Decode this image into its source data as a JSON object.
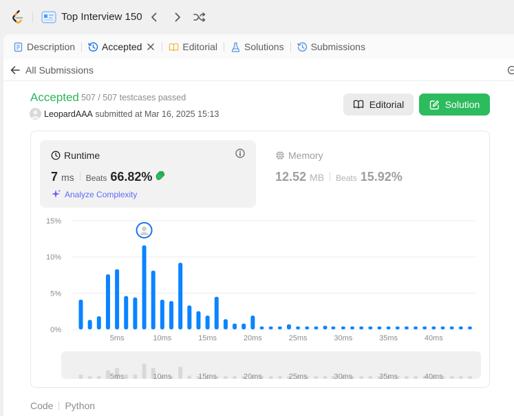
{
  "topbar": {
    "list_title": "Top Interview 150",
    "icons": [
      "leetcode-logo",
      "study-plan-icon",
      "chevron-left-icon",
      "chevron-right-icon",
      "shuffle-icon"
    ]
  },
  "tabs": [
    {
      "label": "Description",
      "icon": "description-icon",
      "active": false
    },
    {
      "label": "Accepted",
      "icon": "history-icon",
      "active": true,
      "closable": true
    },
    {
      "label": "Editorial",
      "icon": "book-icon",
      "active": false
    },
    {
      "label": "Solutions",
      "icon": "flask-icon",
      "active": false
    },
    {
      "label": "Submissions",
      "icon": "history-icon",
      "active": false
    }
  ],
  "crumb": {
    "label": "All Submissions"
  },
  "submission": {
    "status": "Accepted",
    "testcases": "507 / 507 testcases passed",
    "user": "LeopardAAA",
    "submitted_text": "submitted at Mar 16, 2025 15:13"
  },
  "buttons": {
    "editorial": "Editorial",
    "solution": "Solution"
  },
  "runtime": {
    "title": "Runtime",
    "value": "7",
    "unit": "ms",
    "beats_label": "Beats",
    "beats_value": "66.82%",
    "analyze": "Analyze Complexity"
  },
  "memory": {
    "title": "Memory",
    "value": "12.52",
    "unit": "MB",
    "beats_label": "Beats",
    "beats_value": "15.92%"
  },
  "footer": {
    "code_label": "Code",
    "language": "Python"
  },
  "colors": {
    "accent_green": "#2cbb5d",
    "bar_blue": "#0a84ff",
    "link_purple": "#5b6cf6"
  },
  "chart_data": {
    "type": "bar",
    "title": "",
    "xlabel": "",
    "ylabel": "",
    "y_ticks": [
      "15%",
      "10%",
      "5%",
      "0%"
    ],
    "ylim": [
      0,
      15
    ],
    "x_tick_labels": [
      "5ms",
      "10ms",
      "15ms",
      "20ms",
      "25ms",
      "30ms",
      "35ms",
      "40ms"
    ],
    "x_tick_values": [
      5,
      10,
      15,
      20,
      25,
      30,
      35,
      40
    ],
    "x": [
      1,
      2,
      3,
      4,
      5,
      6,
      7,
      8,
      9,
      10,
      11,
      12,
      13,
      14,
      15,
      16,
      17,
      18,
      19,
      20,
      21,
      22,
      23,
      24,
      25,
      26,
      27,
      28,
      28.9,
      30,
      31,
      32,
      33,
      34,
      35,
      36,
      37,
      38,
      39,
      40,
      41,
      42,
      43,
      44
    ],
    "values": [
      4.1,
      1.3,
      1.8,
      7.6,
      8.3,
      4.6,
      4.4,
      11.6,
      8.1,
      4.1,
      3.9,
      9.2,
      3.3,
      2.5,
      1.9,
      4.5,
      1.4,
      0.8,
      0.8,
      1.9,
      0.4,
      0.4,
      0.4,
      0.7,
      0.4,
      0.4,
      0.4,
      0.5,
      0.4,
      0.4,
      0.4,
      0.4,
      0.4,
      0.4,
      0.4,
      0.4,
      0.4,
      0.4,
      0.4,
      0.4,
      0.4,
      0.4,
      0.4,
      0.4
    ],
    "highlight_x": 8,
    "overview_values": [
      0.8,
      0.4,
      0.4,
      1.6,
      2.0,
      0.8,
      0.8,
      2.8,
      2.0,
      0.4,
      0.4,
      2.2,
      0.6,
      0.4,
      0.4,
      0.4,
      0.4,
      0.4,
      0.4,
      0.4,
      0.4,
      0.4,
      0.4,
      0.4,
      0.4,
      0.4,
      0.4,
      0.4,
      0.4,
      0.4,
      0.4,
      0.4,
      0.4,
      0.4,
      0.4,
      0.4,
      0.4,
      0.4,
      0.4,
      0.4,
      0.4,
      0.4,
      0.4,
      0.4
    ]
  }
}
